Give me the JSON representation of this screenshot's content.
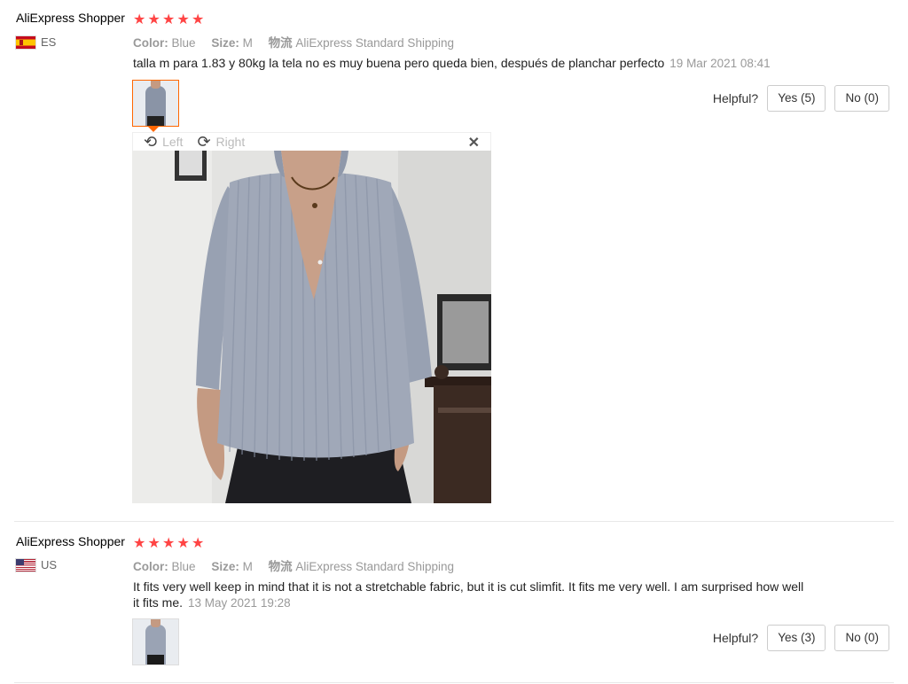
{
  "reviews": [
    {
      "user": "AliExpress Shopper",
      "country": "ES",
      "color_label": "Color:",
      "color_value": "Blue",
      "size_label": "Size:",
      "size_value": "M",
      "shipping_label": "物流",
      "shipping_value": "AliExpress Standard Shipping",
      "text": "talla m para 1.83 y 80kg la tela no es muy buena pero queda bien, después de planchar perfecto",
      "date": "19 Mar 2021 08:41",
      "helpful_label": "Helpful?",
      "yes_label": "Yes (5)",
      "no_label": "No (0)",
      "rating": 5
    },
    {
      "user": "AliExpress Shopper",
      "country": "US",
      "color_label": "Color:",
      "color_value": "Blue",
      "size_label": "Size:",
      "size_value": "M",
      "shipping_label": "物流",
      "shipping_value": "AliExpress Standard Shipping",
      "text": "It fits very well keep in mind that it is not a stretchable fabric, but it is cut slimfit. It fits me very well. I am surprised how well it fits me.",
      "date": "13 May 2021 19:28",
      "helpful_label": "Helpful?",
      "yes_label": "Yes (3)",
      "no_label": "No (0)",
      "rating": 5
    }
  ],
  "viewer": {
    "rotate_left_label": "Left",
    "rotate_right_label": "Right",
    "rotate_left_icon": "rotate-left-icon",
    "rotate_right_icon": "rotate-right-icon",
    "close_icon": "close-icon"
  },
  "colors": {
    "star": "#ff4747",
    "active_thumb_border": "#ff6600"
  }
}
